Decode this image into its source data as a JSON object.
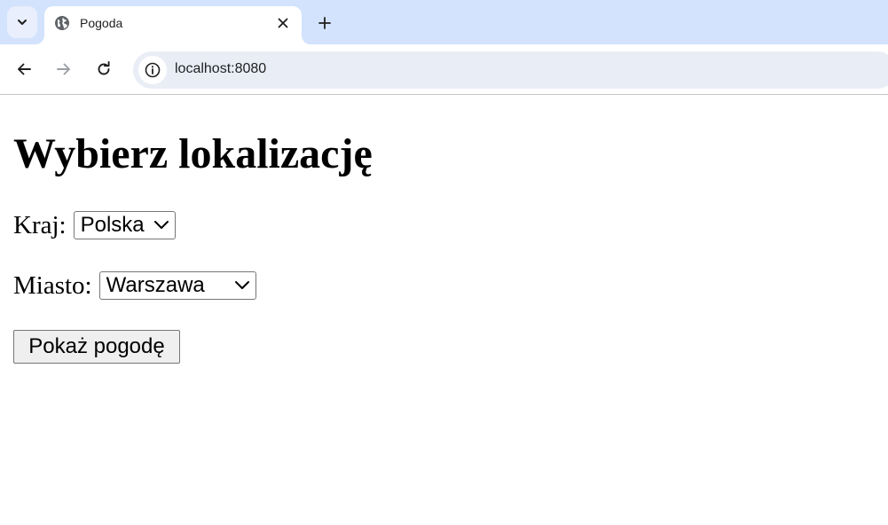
{
  "browser": {
    "tab": {
      "title": "Pogoda",
      "favicon": "globe-icon",
      "close_icon": "close-icon"
    },
    "tab_search_icon": "chevron-down-icon",
    "new_tab_icon": "plus-icon",
    "nav": {
      "back_icon": "arrow-left-icon",
      "forward_icon": "arrow-right-icon",
      "reload_icon": "reload-icon"
    },
    "address_bar": {
      "site_info_icon": "info-icon",
      "url": "localhost:8080"
    },
    "colors": {
      "tabstrip": "#d3e3fd",
      "omnibox": "#e9eef6"
    }
  },
  "page": {
    "heading": "Wybierz lokalizację",
    "country": {
      "label": "Kraj:",
      "selected": "Polska"
    },
    "city": {
      "label": "Miasto:",
      "selected": "Warszawa"
    },
    "submit_label": "Pokaż pogodę"
  }
}
